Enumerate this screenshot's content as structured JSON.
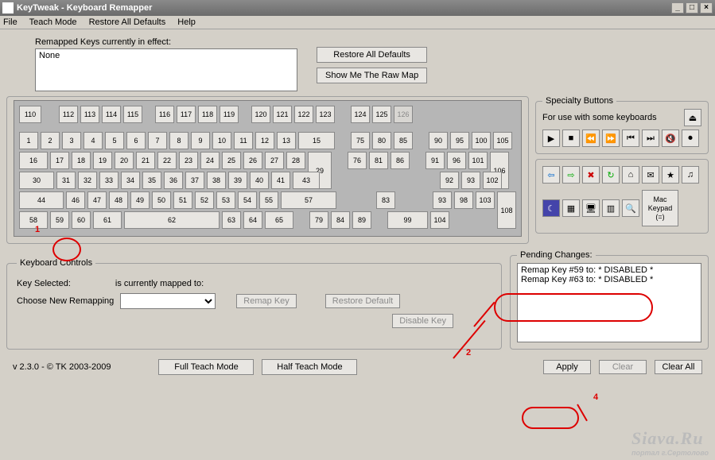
{
  "title": "KeyTweak  -  Keyboard Remapper",
  "menu": {
    "file": "File",
    "teach": "Teach Mode",
    "restore": "Restore All Defaults",
    "help": "Help"
  },
  "remapped": {
    "label": "Remapped Keys currently in effect:",
    "value": "None"
  },
  "buttons": {
    "restoreAll": "Restore All Defaults",
    "showRaw": "Show Me The Raw Map",
    "remapKey": "Remap Key",
    "restoreDefault": "Restore Default",
    "disableKey": "Disable Key",
    "fullTeach": "Full Teach Mode",
    "halfTeach": "Half Teach Mode",
    "apply": "Apply",
    "clear": "Clear",
    "clearAll": "Clear All"
  },
  "groups": {
    "specialty": "Specialty Buttons",
    "specialtySub": "For use with some keyboards",
    "kbdControls": "Keyboard Controls",
    "pending": "Pending Changes:",
    "mac": "Mac Keypad (=)"
  },
  "controls": {
    "keySelected": "Key Selected:",
    "mappedTo": "is currently mapped to:",
    "chooseNew": "Choose New Remapping"
  },
  "pending": {
    "line1": "Remap Key #59 to:  * DISABLED *",
    "line2": "Remap Key #63 to:  * DISABLED *"
  },
  "footer": {
    "version": "v 2.3.0 - © TK 2003-2009"
  },
  "kbd": {
    "r1a": [
      "110"
    ],
    "r1b": [
      "112",
      "113",
      "114",
      "115"
    ],
    "r1c": [
      "116",
      "117",
      "118",
      "119"
    ],
    "r1d": [
      "120",
      "121",
      "122",
      "123"
    ],
    "r1e": [
      "124",
      "125",
      "126"
    ],
    "r2a": [
      "1",
      "2",
      "3",
      "4",
      "5",
      "6",
      "7",
      "8",
      "9",
      "10",
      "11",
      "12",
      "13",
      "15"
    ],
    "r2b": [
      "75",
      "80",
      "85"
    ],
    "r2c": [
      "90",
      "95",
      "100",
      "105"
    ],
    "r3a": [
      "16",
      "17",
      "18",
      "19",
      "20",
      "21",
      "22",
      "23",
      "24",
      "25",
      "26",
      "27",
      "28"
    ],
    "r3b": [
      "76",
      "81",
      "86"
    ],
    "r3c": [
      "91",
      "96",
      "101"
    ],
    "r4a": [
      "30",
      "31",
      "32",
      "33",
      "34",
      "35",
      "36",
      "37",
      "38",
      "39",
      "40",
      "41",
      "43"
    ],
    "r4c": [
      "92",
      "93",
      "102"
    ],
    "r5a": [
      "44",
      "46",
      "47",
      "48",
      "49",
      "50",
      "51",
      "52",
      "53",
      "54",
      "55",
      "57"
    ],
    "r5b": [
      "83"
    ],
    "r5c": [
      "93",
      "98",
      "103"
    ],
    "r6a": [
      "58",
      "59",
      "60",
      "61",
      "62",
      "63",
      "64",
      "65"
    ],
    "r6b": [
      "79",
      "84",
      "89"
    ],
    "r6c": [
      "99",
      "104"
    ],
    "tall29": "29",
    "tall43": "43",
    "tall106": "106",
    "tall108": "108"
  },
  "annot": {
    "a1": "1",
    "a2": "2",
    "a4": "4"
  }
}
